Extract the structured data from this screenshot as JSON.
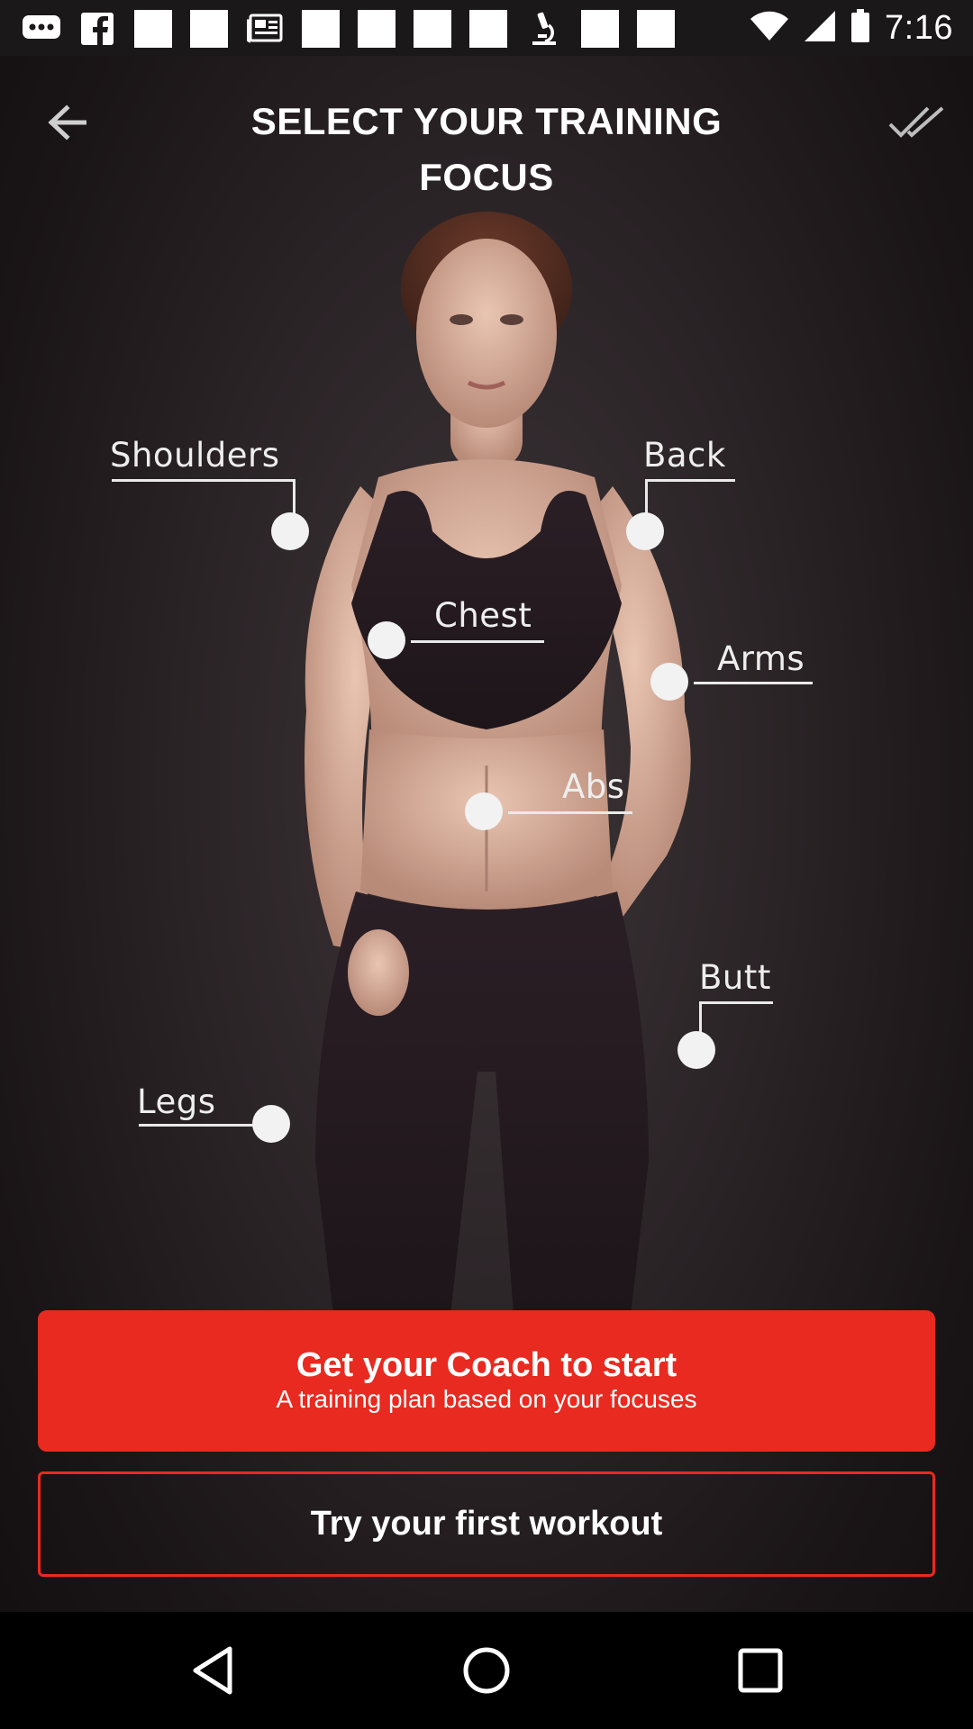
{
  "status_bar": {
    "time": "7:16",
    "icons": [
      "message-icon",
      "facebook-icon",
      "white-square-icon",
      "white-square-icon",
      "news-icon",
      "white-square-icon",
      "white-square-icon",
      "white-square-icon",
      "white-square-icon",
      "microscope-icon",
      "white-square-icon",
      "white-square-icon",
      "wifi-icon",
      "signal-icon",
      "battery-icon"
    ]
  },
  "header": {
    "title": "SELECT YOUR TRAINING FOCUS"
  },
  "body_parts": [
    {
      "id": "shoulders",
      "label": "Shoulders"
    },
    {
      "id": "back",
      "label": "Back"
    },
    {
      "id": "chest",
      "label": "Chest"
    },
    {
      "id": "arms",
      "label": "Arms"
    },
    {
      "id": "abs",
      "label": "Abs"
    },
    {
      "id": "butt",
      "label": "Butt"
    },
    {
      "id": "legs",
      "label": "Legs"
    }
  ],
  "coach_button": {
    "title": "Get your Coach to start",
    "subtitle": "A training plan based on your focuses"
  },
  "workout_button": {
    "label": "Try your first workout"
  },
  "colors": {
    "accent": "#e82a20",
    "background": "#2a2326"
  }
}
